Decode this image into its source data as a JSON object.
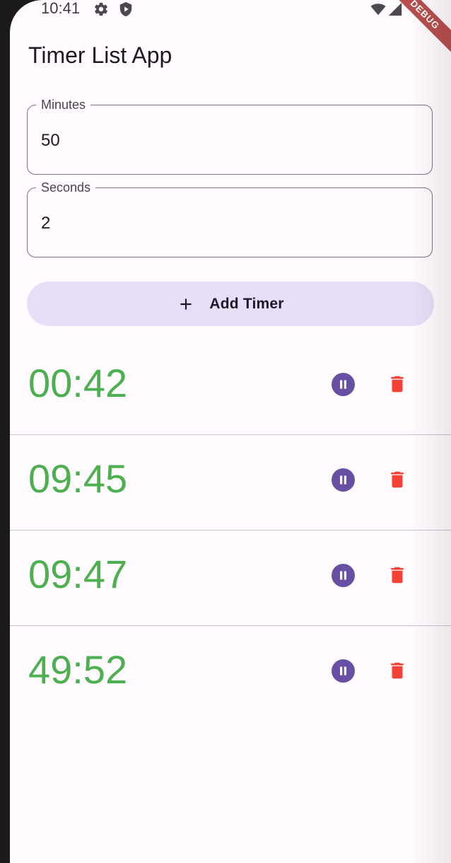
{
  "status_bar": {
    "time": "10:41",
    "icons": [
      "gear-icon",
      "shield-icon",
      "wifi-icon",
      "signal-icon"
    ]
  },
  "debug_banner": "DEBUG",
  "app_bar": {
    "title": "Timer List App"
  },
  "form": {
    "minutes": {
      "label": "Minutes",
      "value": "50"
    },
    "seconds": {
      "label": "Seconds",
      "value": "2"
    },
    "add_button": {
      "label": "Add Timer",
      "icon": "plus-icon"
    }
  },
  "timers": [
    {
      "time": "00:42",
      "pause_icon": "pause-icon",
      "delete_icon": "trash-icon"
    },
    {
      "time": "09:45",
      "pause_icon": "pause-icon",
      "delete_icon": "trash-icon"
    },
    {
      "time": "09:47",
      "pause_icon": "pause-icon",
      "delete_icon": "trash-icon"
    },
    {
      "time": "49:52",
      "pause_icon": "pause-icon",
      "delete_icon": "trash-icon"
    }
  ],
  "colors": {
    "timer_text": "#4caf50",
    "pause_button": "#6750a4",
    "delete_icon": "#f44336",
    "add_button_bg": "#e8def8",
    "background": "#fffbfe"
  }
}
